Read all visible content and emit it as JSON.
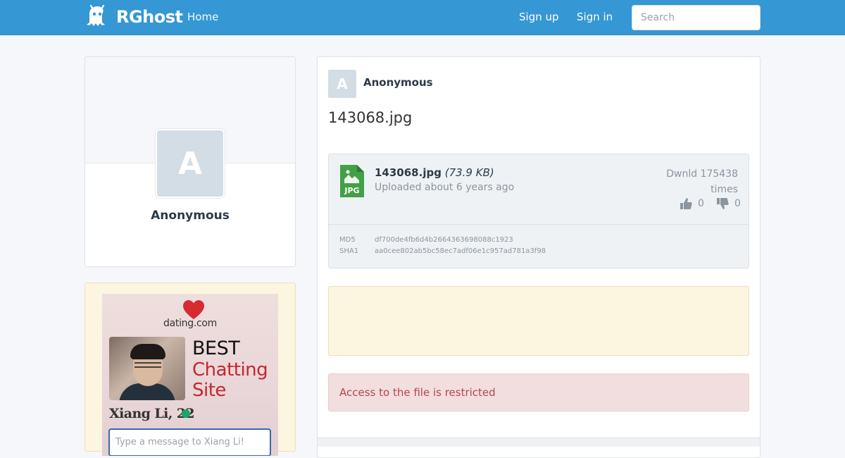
{
  "header": {
    "brand": "RGhost",
    "nav_home": "Home",
    "sign_up": "Sign up",
    "sign_in": "Sign in",
    "search_placeholder": "Search"
  },
  "profile": {
    "avatar_letter": "A",
    "name": "Anonymous"
  },
  "ad": {
    "brand": "dating.com",
    "headline_1": "BEST",
    "headline_2": "Chatting",
    "headline_3": "Site",
    "person": "Xiang Li, 22",
    "input_placeholder": "Type a message to Xiang Li!"
  },
  "file": {
    "owner_letter": "A",
    "owner": "Anonymous",
    "title": "143068.jpg",
    "name": "143068.jpg",
    "size": "(73.9 KB)",
    "uploaded": "Uploaded about 6 years ago",
    "downloads_line1": "Dwnld 175438",
    "downloads_line2": "times",
    "likes": "0",
    "dislikes": "0",
    "icon_label": "JPG",
    "hashes": [
      {
        "label": "MD5",
        "value": "df700de4fb6d4b2664363698088c1923"
      },
      {
        "label": "SHA1",
        "value": "aa0cee802ab5bc58ec7adf06e1c957ad781a3f98"
      }
    ]
  },
  "alert": "Access to the file is restricted",
  "colors": {
    "header": "#3597d3",
    "file_icon": "#43a047",
    "alert_text": "#b6464a",
    "ad_bg": "#fcf5e0"
  }
}
